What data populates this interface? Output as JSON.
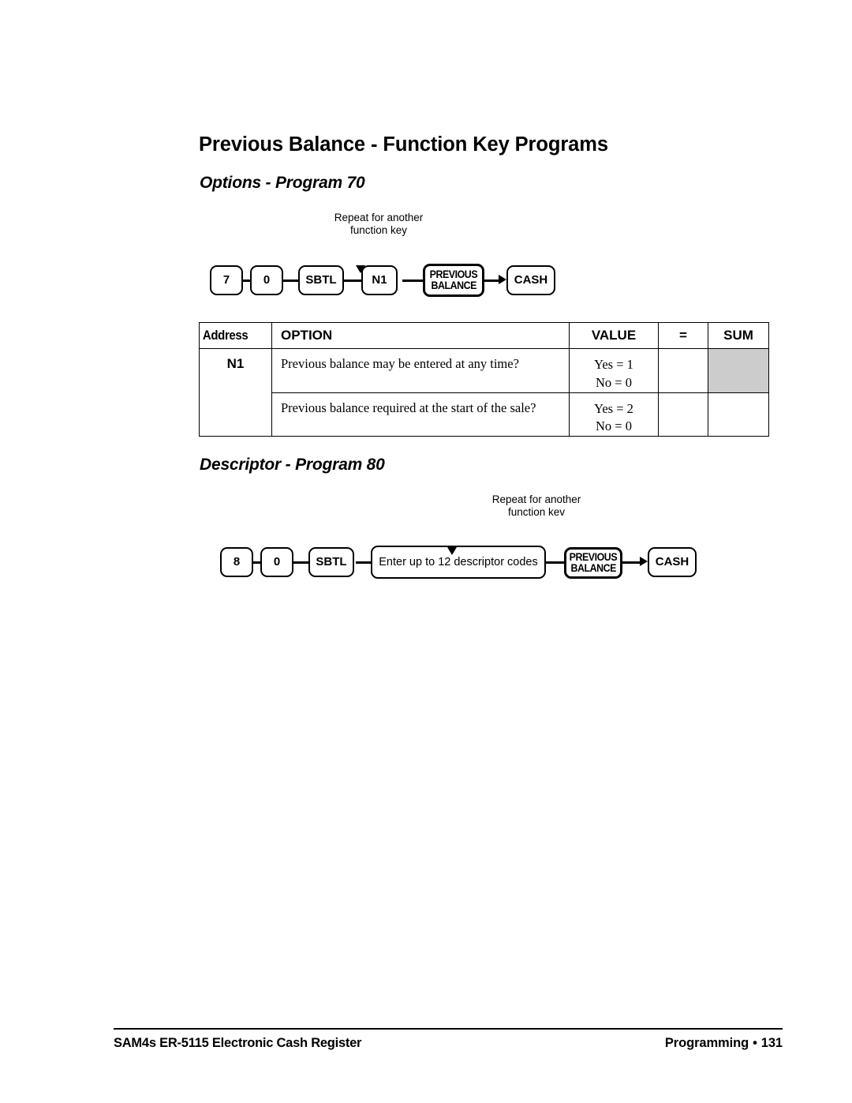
{
  "page": {
    "title": "Previous Balance - Function Key Programs"
  },
  "sections": {
    "options": {
      "heading": "Options - Program 70"
    },
    "descriptor": {
      "heading": "Descriptor - Program 80"
    }
  },
  "diagram_options": {
    "repeat_note_line1": "Repeat for another",
    "repeat_note_line2": "function key",
    "keys": [
      {
        "label": "7"
      },
      {
        "label": "0"
      },
      {
        "label": "SBTL"
      },
      {
        "label": "N1"
      },
      {
        "label_line1": "PREVIOUS",
        "label_line2": "BALANCE"
      },
      {
        "label": "CASH"
      }
    ]
  },
  "diagram_descriptor": {
    "repeat_note_line1": "Repeat for another",
    "repeat_note_line2": "function kev",
    "keys": [
      {
        "label": "8"
      },
      {
        "label": "0"
      },
      {
        "label": "SBTL"
      },
      {
        "label": "Enter up to 12 descriptor codes"
      },
      {
        "label_line1": "PREVIOUS",
        "label_line2": "BALANCE"
      },
      {
        "label": "CASH"
      }
    ]
  },
  "options_table": {
    "headers": {
      "address": "Address",
      "option": "OPTION",
      "value": "VALUE",
      "equals": "=",
      "sum": "SUM"
    },
    "address": "N1",
    "rows": [
      {
        "option": "Previous balance may be entered at any time?",
        "value_yes": "Yes = 1",
        "value_no": "No = 0",
        "sum_shaded": true
      },
      {
        "option": "Previous balance required at the start of the sale?",
        "value_yes": "Yes = 2",
        "value_no": "No = 0",
        "sum_shaded": false
      }
    ]
  },
  "footer": {
    "left": "SAM4s ER-5115 Electronic Cash Register",
    "right_label": "Programming",
    "bullet": "•",
    "page_number": "131"
  },
  "colors": {
    "shaded_cell": "#cccccc",
    "ink": "#000000",
    "paper": "#ffffff"
  }
}
